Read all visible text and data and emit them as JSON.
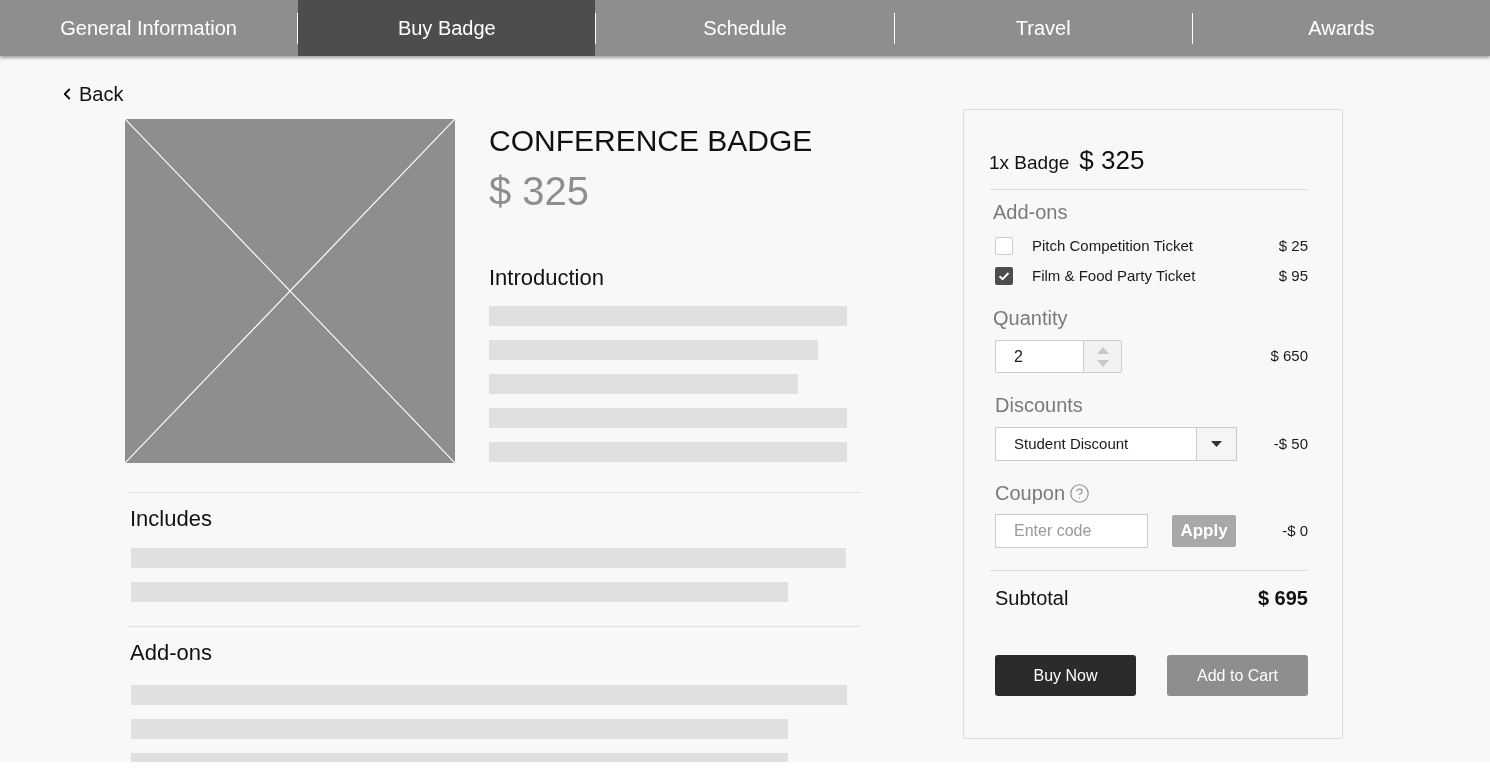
{
  "nav": {
    "tabs": [
      {
        "label": "General Information",
        "selected": false
      },
      {
        "label": "Buy Badge",
        "selected": true
      },
      {
        "label": "Schedule",
        "selected": false
      },
      {
        "label": "Travel",
        "selected": false
      },
      {
        "label": "Awards",
        "selected": false
      }
    ]
  },
  "back_link": {
    "label": "Back"
  },
  "product": {
    "title": "CONFERENCE BADGE",
    "price": "$ 325",
    "introduction": {
      "heading": "Introduction"
    },
    "sections": [
      {
        "heading": "Includes"
      },
      {
        "heading": "Add-ons"
      }
    ]
  },
  "order_summary": {
    "item": {
      "label": "1x Badge",
      "price": "$ 325"
    },
    "addons": {
      "heading": "Add-ons",
      "items": [
        {
          "label": "Pitch Competition Ticket",
          "price": "$ 25",
          "checked": false
        },
        {
          "label": "Film & Food Party Ticket",
          "price": "$ 95",
          "checked": true
        }
      ]
    },
    "quantity": {
      "heading": "Quantity",
      "value": "2",
      "amount": "$ 650"
    },
    "discounts": {
      "heading": "Discounts",
      "value": "Student Discount",
      "amount": "-$ 50"
    },
    "coupon": {
      "heading": "Coupon",
      "placeholder": "Enter code",
      "apply_button": {
        "label": "Apply",
        "disabled": true
      },
      "amount": "-$ 0"
    },
    "subtotal": {
      "label": "Subtotal",
      "amount": "$ 695"
    },
    "buttons": [
      {
        "label": "Buy Now",
        "kind": "primary"
      },
      {
        "label": "Add to Cart",
        "kind": "secondary"
      }
    ]
  }
}
